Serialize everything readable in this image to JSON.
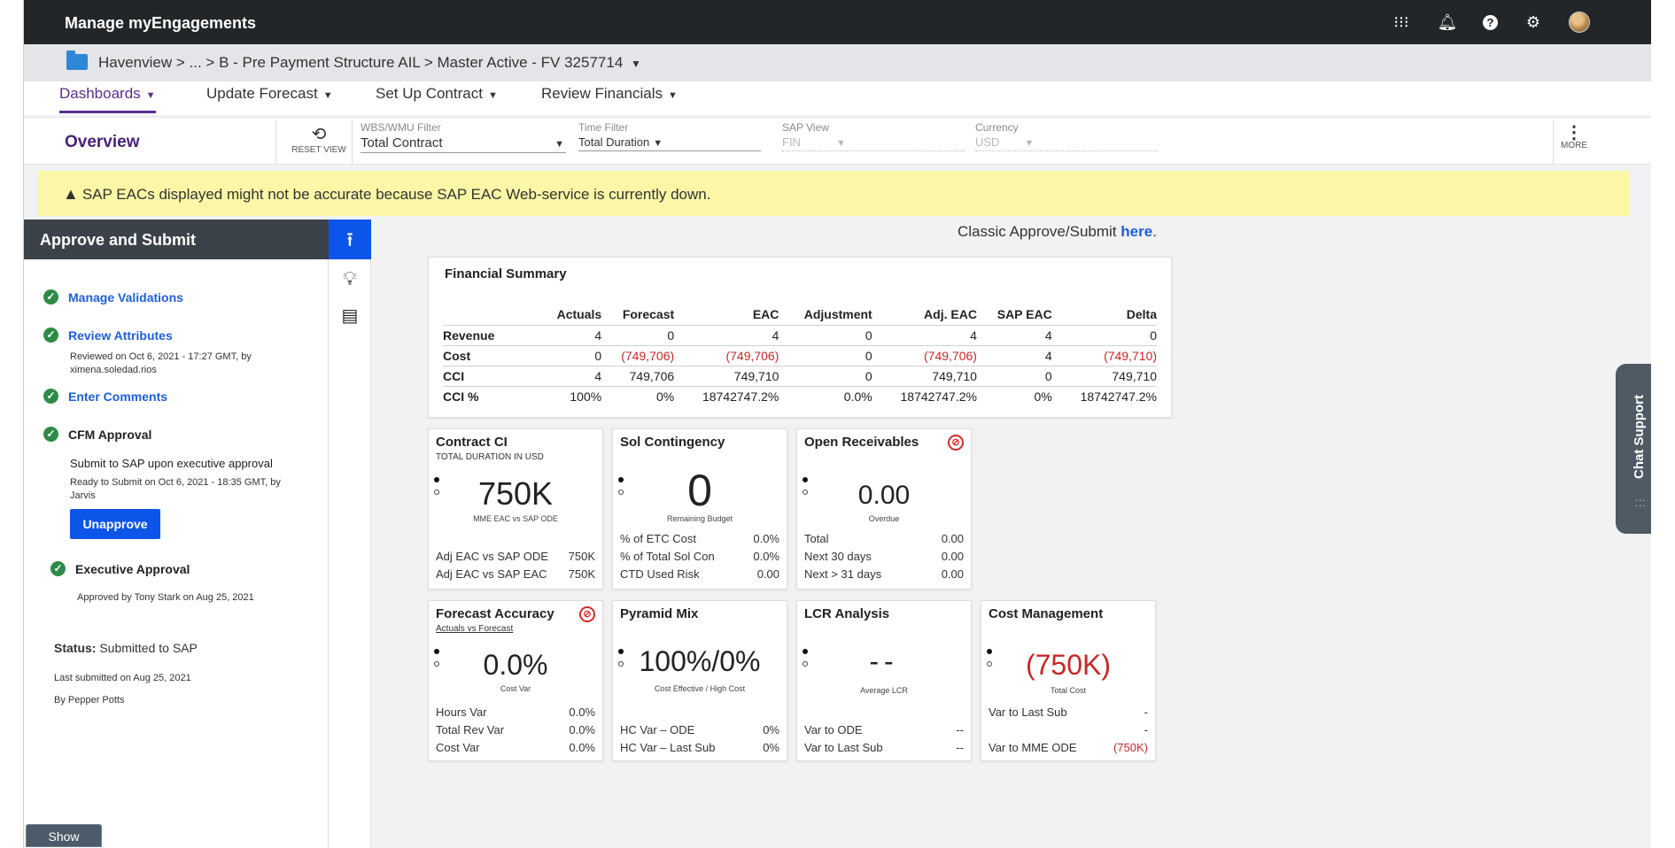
{
  "app": {
    "title": "Manage myEngagements"
  },
  "topbar": {
    "icons": [
      "apps-grid-icon",
      "bell-icon",
      "help-icon",
      "gear-icon",
      "avatar"
    ]
  },
  "breadcrumb": {
    "text": "Havenview > ... > B - Pre Payment Structure AIL > Master Active - FV 3257714",
    "caret": "▼"
  },
  "nav": {
    "tabs": [
      {
        "label": "Dashboards",
        "active": true
      },
      {
        "label": "Update Forecast",
        "active": false
      },
      {
        "label": "Set Up Contract",
        "active": false
      },
      {
        "label": "Review Financials",
        "active": false
      }
    ]
  },
  "filters": {
    "page_title": "Overview",
    "reset_label": "RESET VIEW",
    "wbs": {
      "label": "WBS/WMU Filter",
      "value": "Total Contract"
    },
    "time": {
      "label": "Time Filter",
      "value": "Total Duration"
    },
    "sap": {
      "label": "SAP View",
      "value": "FIN"
    },
    "currency": {
      "label": "Currency",
      "value": "USD"
    },
    "more_label": "MORE"
  },
  "warning": {
    "text": "SAP EACs displayed might not be accurate because SAP EAC Web-service is currently down."
  },
  "approve": {
    "title": "Approve and Submit",
    "steps": [
      {
        "label": "Manage Validations"
      },
      {
        "label": "Review Attributes",
        "note": "Reviewed on Oct 6, 2021 - 17:27 GMT, by ximena.soledad.rios"
      },
      {
        "label": "Enter Comments"
      },
      {
        "label": "CFM Approval",
        "note_main": "Submit to SAP upon executive approval",
        "note": "Ready to Submit on Oct 6, 2021 - 18:35 GMT, by Jarvis"
      },
      {
        "label": "Executive Approval",
        "note": "Approved by Tony Stark on Aug 25, 2021"
      }
    ],
    "unapprove_label": "Unapprove",
    "status_label": "Status:",
    "status_value": "Submitted to SAP",
    "last_submitted": "Last submitted on Aug 25, 2021",
    "by": "By Pepper Potts",
    "show_label": "Show"
  },
  "main": {
    "classic_text": "Classic Approve/Submit",
    "classic_link": "here",
    "classic_end": "."
  },
  "financial_summary": {
    "title": "Financial Summary",
    "columns": [
      "",
      "Actuals",
      "Forecast",
      "EAC",
      "Adjustment",
      "Adj. EAC",
      "SAP EAC",
      "Delta"
    ],
    "rows": [
      [
        "Revenue",
        "4",
        "0",
        "4",
        "0",
        "4",
        "4",
        "0"
      ],
      [
        "Cost",
        "0",
        "(749,706)",
        "(749,706)",
        "0",
        "(749,706)",
        "4",
        "(749,710)"
      ],
      [
        "CCI",
        "4",
        "749,706",
        "749,710",
        "0",
        "749,710",
        "0",
        "749,710"
      ],
      [
        "CCI %",
        "100%",
        "0%",
        "18742747.2%",
        "0.0%",
        "18742747.2%",
        "0%",
        "18742747.2%"
      ]
    ]
  },
  "tiles": {
    "contract_ci": {
      "title": "Contract CI",
      "sub": "TOTAL DURATION IN USD",
      "value": "750K",
      "value_label": "MME EAC vs SAP ODE",
      "rows": [
        [
          "Adj EAC vs SAP ODE",
          "750K"
        ],
        [
          "Adj EAC vs SAP EAC",
          "750K"
        ]
      ]
    },
    "sol_contingency": {
      "title": "Sol Contingency",
      "value": "0",
      "value_label": "Remaining Budget",
      "rows": [
        [
          "% of ETC Cost",
          "0.0%"
        ],
        [
          "% of Total Sol Con",
          "0.0%"
        ],
        [
          "CTD Used Risk",
          "0.00"
        ]
      ]
    },
    "open_receivables": {
      "title": "Open Receivables",
      "value": "0.00",
      "value_label": "Overdue",
      "rows": [
        [
          "Total",
          "0.00"
        ],
        [
          "Next 30 days",
          "0.00"
        ],
        [
          "Next > 31 days",
          "0.00"
        ]
      ]
    },
    "forecast_accuracy": {
      "title": "Forecast Accuracy",
      "sub": "Actuals vs Forecast",
      "value": "0.0%",
      "value_label": "Cost Var",
      "rows": [
        [
          "Hours Var",
          "0.0%"
        ],
        [
          "Total Rev Var",
          "0.0%"
        ],
        [
          "Cost Var",
          "0.0%"
        ]
      ]
    },
    "pyramid_mix": {
      "title": "Pyramid Mix",
      "value": "100%/0%",
      "value_label": "Cost Effective / High Cost",
      "rows": [
        [
          "HC Var – ODE",
          "0%"
        ],
        [
          "HC Var – Last Sub",
          "0%"
        ]
      ]
    },
    "lcr_analysis": {
      "title": "LCR Analysis",
      "value": "--",
      "value_label": "Average LCR",
      "rows": [
        [
          "Var to ODE",
          "--"
        ],
        [
          "Var to Last Sub",
          "--"
        ]
      ]
    },
    "cost_management": {
      "title": "Cost Management",
      "value": "(750K)",
      "value_label": "Total Cost",
      "rows": [
        [
          "Var to Last Sub",
          "-"
        ],
        [
          "",
          "-"
        ],
        [
          "Var to MME ODE",
          "(750K)"
        ]
      ]
    }
  },
  "chat": {
    "label": "Chat Support"
  },
  "colors": {
    "accent": "#5b2d8e",
    "primary_button": "#0d55e8",
    "negative": "#c62828",
    "success": "#2e8b47",
    "warning_bg": "#fbf7a6"
  }
}
